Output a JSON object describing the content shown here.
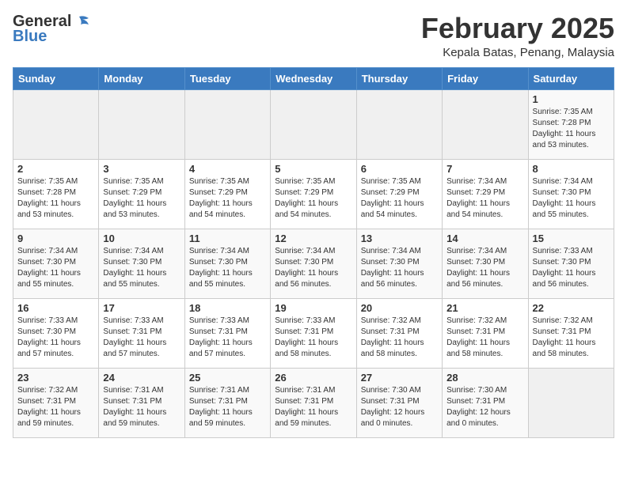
{
  "header": {
    "logo_general": "General",
    "logo_blue": "Blue",
    "month_title": "February 2025",
    "location": "Kepala Batas, Penang, Malaysia"
  },
  "calendar": {
    "weekdays": [
      "Sunday",
      "Monday",
      "Tuesday",
      "Wednesday",
      "Thursday",
      "Friday",
      "Saturday"
    ],
    "weeks": [
      [
        {
          "day": "",
          "info": ""
        },
        {
          "day": "",
          "info": ""
        },
        {
          "day": "",
          "info": ""
        },
        {
          "day": "",
          "info": ""
        },
        {
          "day": "",
          "info": ""
        },
        {
          "day": "",
          "info": ""
        },
        {
          "day": "1",
          "info": "Sunrise: 7:35 AM\nSunset: 7:28 PM\nDaylight: 11 hours\nand 53 minutes."
        }
      ],
      [
        {
          "day": "2",
          "info": "Sunrise: 7:35 AM\nSunset: 7:28 PM\nDaylight: 11 hours\nand 53 minutes."
        },
        {
          "day": "3",
          "info": "Sunrise: 7:35 AM\nSunset: 7:29 PM\nDaylight: 11 hours\nand 53 minutes."
        },
        {
          "day": "4",
          "info": "Sunrise: 7:35 AM\nSunset: 7:29 PM\nDaylight: 11 hours\nand 54 minutes."
        },
        {
          "day": "5",
          "info": "Sunrise: 7:35 AM\nSunset: 7:29 PM\nDaylight: 11 hours\nand 54 minutes."
        },
        {
          "day": "6",
          "info": "Sunrise: 7:35 AM\nSunset: 7:29 PM\nDaylight: 11 hours\nand 54 minutes."
        },
        {
          "day": "7",
          "info": "Sunrise: 7:34 AM\nSunset: 7:29 PM\nDaylight: 11 hours\nand 54 minutes."
        },
        {
          "day": "8",
          "info": "Sunrise: 7:34 AM\nSunset: 7:30 PM\nDaylight: 11 hours\nand 55 minutes."
        }
      ],
      [
        {
          "day": "9",
          "info": "Sunrise: 7:34 AM\nSunset: 7:30 PM\nDaylight: 11 hours\nand 55 minutes."
        },
        {
          "day": "10",
          "info": "Sunrise: 7:34 AM\nSunset: 7:30 PM\nDaylight: 11 hours\nand 55 minutes."
        },
        {
          "day": "11",
          "info": "Sunrise: 7:34 AM\nSunset: 7:30 PM\nDaylight: 11 hours\nand 55 minutes."
        },
        {
          "day": "12",
          "info": "Sunrise: 7:34 AM\nSunset: 7:30 PM\nDaylight: 11 hours\nand 56 minutes."
        },
        {
          "day": "13",
          "info": "Sunrise: 7:34 AM\nSunset: 7:30 PM\nDaylight: 11 hours\nand 56 minutes."
        },
        {
          "day": "14",
          "info": "Sunrise: 7:34 AM\nSunset: 7:30 PM\nDaylight: 11 hours\nand 56 minutes."
        },
        {
          "day": "15",
          "info": "Sunrise: 7:33 AM\nSunset: 7:30 PM\nDaylight: 11 hours\nand 56 minutes."
        }
      ],
      [
        {
          "day": "16",
          "info": "Sunrise: 7:33 AM\nSunset: 7:30 PM\nDaylight: 11 hours\nand 57 minutes."
        },
        {
          "day": "17",
          "info": "Sunrise: 7:33 AM\nSunset: 7:31 PM\nDaylight: 11 hours\nand 57 minutes."
        },
        {
          "day": "18",
          "info": "Sunrise: 7:33 AM\nSunset: 7:31 PM\nDaylight: 11 hours\nand 57 minutes."
        },
        {
          "day": "19",
          "info": "Sunrise: 7:33 AM\nSunset: 7:31 PM\nDaylight: 11 hours\nand 58 minutes."
        },
        {
          "day": "20",
          "info": "Sunrise: 7:32 AM\nSunset: 7:31 PM\nDaylight: 11 hours\nand 58 minutes."
        },
        {
          "day": "21",
          "info": "Sunrise: 7:32 AM\nSunset: 7:31 PM\nDaylight: 11 hours\nand 58 minutes."
        },
        {
          "day": "22",
          "info": "Sunrise: 7:32 AM\nSunset: 7:31 PM\nDaylight: 11 hours\nand 58 minutes."
        }
      ],
      [
        {
          "day": "23",
          "info": "Sunrise: 7:32 AM\nSunset: 7:31 PM\nDaylight: 11 hours\nand 59 minutes."
        },
        {
          "day": "24",
          "info": "Sunrise: 7:31 AM\nSunset: 7:31 PM\nDaylight: 11 hours\nand 59 minutes."
        },
        {
          "day": "25",
          "info": "Sunrise: 7:31 AM\nSunset: 7:31 PM\nDaylight: 11 hours\nand 59 minutes."
        },
        {
          "day": "26",
          "info": "Sunrise: 7:31 AM\nSunset: 7:31 PM\nDaylight: 11 hours\nand 59 minutes."
        },
        {
          "day": "27",
          "info": "Sunrise: 7:30 AM\nSunset: 7:31 PM\nDaylight: 12 hours\nand 0 minutes."
        },
        {
          "day": "28",
          "info": "Sunrise: 7:30 AM\nSunset: 7:31 PM\nDaylight: 12 hours\nand 0 minutes."
        },
        {
          "day": "",
          "info": ""
        }
      ]
    ]
  }
}
